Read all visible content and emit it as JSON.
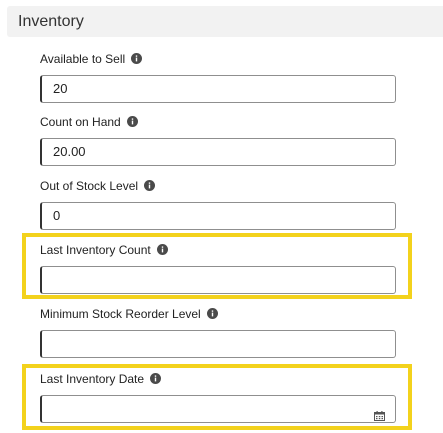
{
  "section": {
    "title": "Inventory"
  },
  "fields": [
    {
      "label": "Available to Sell",
      "value": "20",
      "info_icon": "info-icon"
    },
    {
      "label": "Count on Hand",
      "value": "20.00",
      "info_icon": "info-icon"
    },
    {
      "label": "Out of Stock Level",
      "value": "0",
      "info_icon": "info-icon"
    },
    {
      "label": "Last Inventory Count",
      "value": "",
      "info_icon": "info-icon"
    },
    {
      "label": "Minimum Stock Reorder Level",
      "value": "",
      "info_icon": "info-icon"
    },
    {
      "label": "Last Inventory Date",
      "value": "",
      "info_icon": "info-icon",
      "trailing_icon": "calendar-icon"
    }
  ],
  "colors": {
    "highlight": "#f3d21c",
    "header_bg": "#f2f2f2",
    "info_icon": "#4a4a4a"
  }
}
